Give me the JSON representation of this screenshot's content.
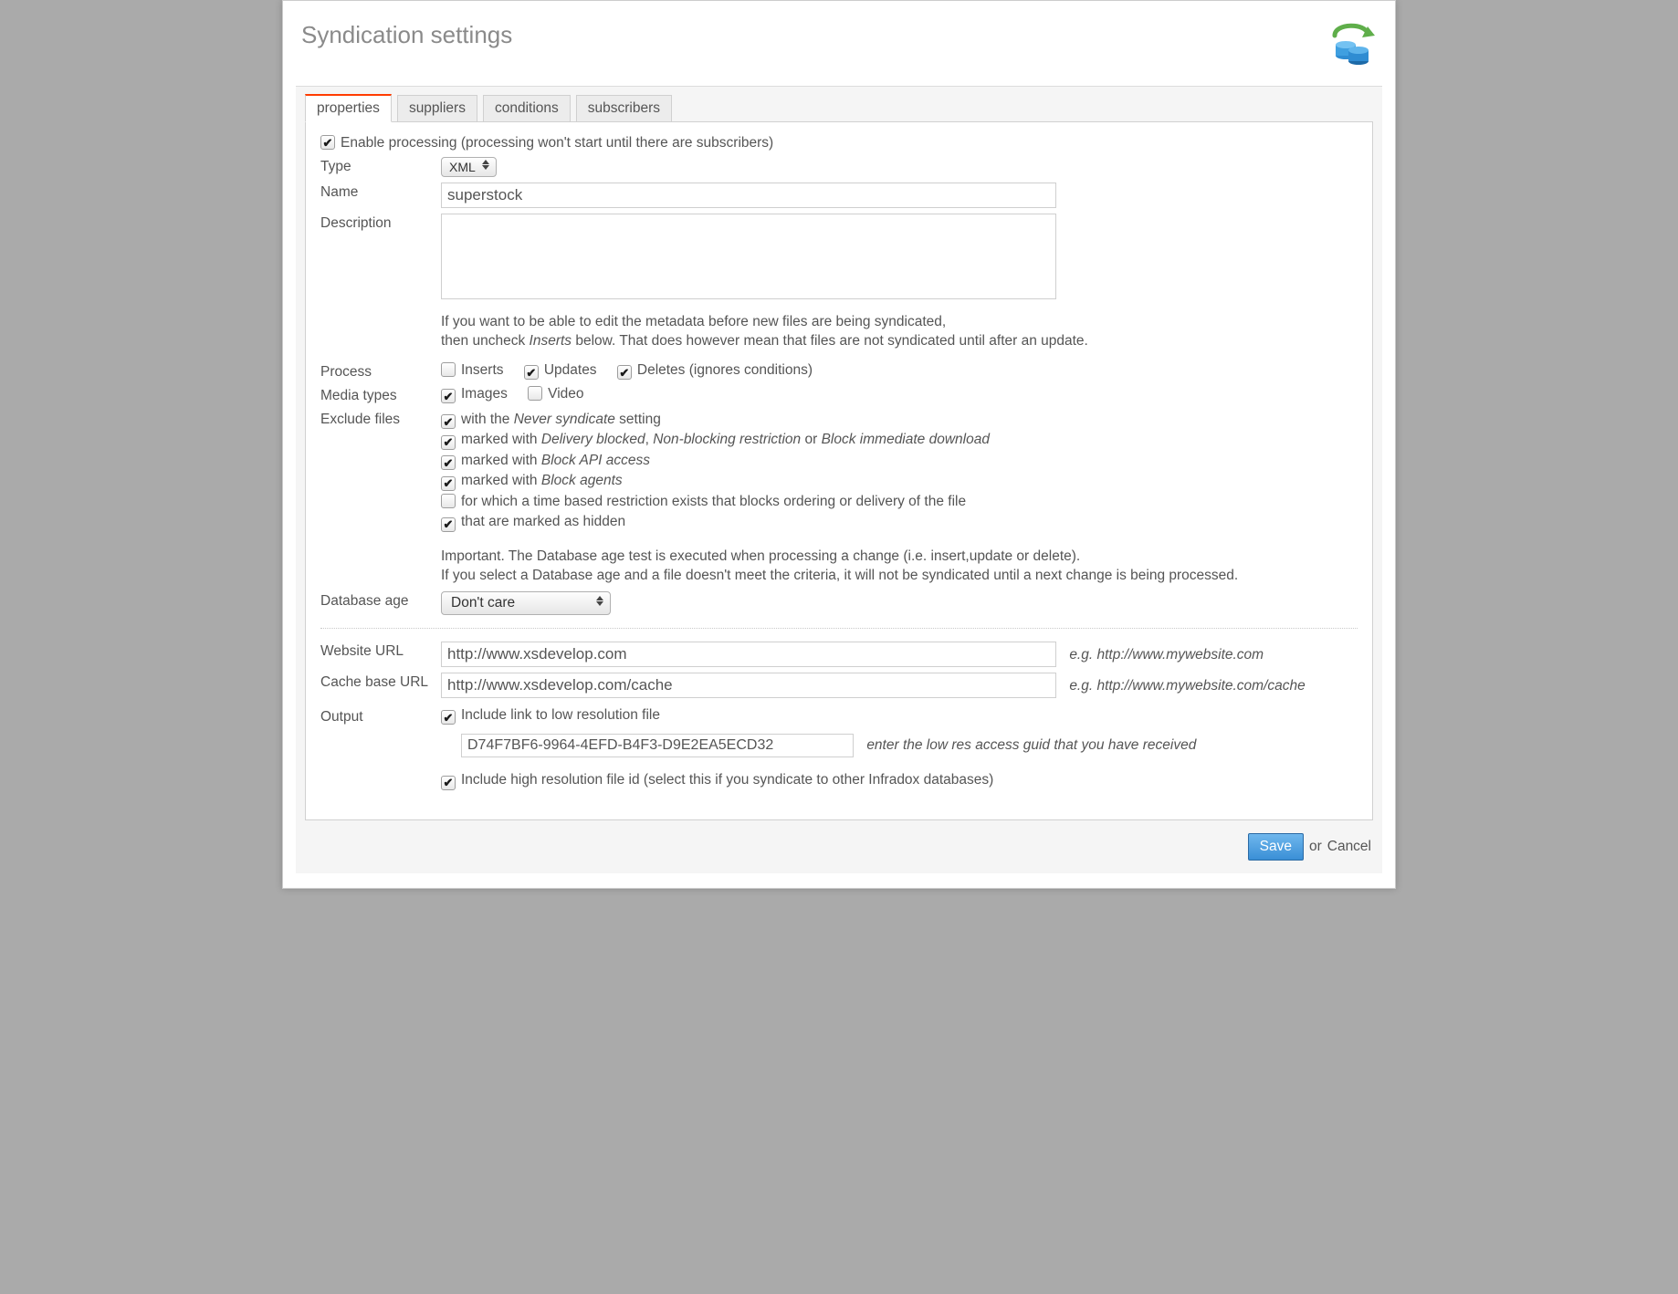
{
  "dialog": {
    "title": "Syndication settings"
  },
  "tabs": {
    "properties": "properties",
    "suppliers": "suppliers",
    "conditions": "conditions",
    "subscribers": "subscribers"
  },
  "enable": {
    "checked": true,
    "label": "Enable processing (processing won't start until there are subscribers)"
  },
  "type": {
    "label": "Type",
    "value": "XML"
  },
  "name": {
    "label": "Name",
    "value": "superstock"
  },
  "description": {
    "label": "Description",
    "value": "",
    "hint1": "If you want to be able to edit the metadata before new files are being syndicated,",
    "hint2_a": "then uncheck ",
    "hint2_em": "Inserts",
    "hint2_b": " below. That does however mean that files are not syndicated until after an update."
  },
  "process": {
    "label": "Process",
    "inserts": {
      "checked": false,
      "label": "Inserts"
    },
    "updates": {
      "checked": true,
      "label": "Updates"
    },
    "deletes": {
      "checked": true,
      "label": "Deletes (ignores conditions)"
    }
  },
  "media": {
    "label": "Media types",
    "images": {
      "checked": true,
      "label": "Images"
    },
    "video": {
      "checked": false,
      "label": "Video"
    }
  },
  "exclude": {
    "label": "Exclude files",
    "e1": {
      "checked": true,
      "pre": "with the ",
      "em": "Never syndicate",
      "post": " setting"
    },
    "e2": {
      "checked": true,
      "pre": "marked with ",
      "em1": "Delivery blocked",
      "mid1": ", ",
      "em2": "Non-blocking restriction",
      "mid2": " or ",
      "em3": "Block immediate download"
    },
    "e3": {
      "checked": true,
      "pre": "marked with ",
      "em": "Block API access"
    },
    "e4": {
      "checked": true,
      "pre": "marked with ",
      "em": "Block agents"
    },
    "e5": {
      "checked": false,
      "text": "for which a time based restriction exists that blocks ordering or delivery of the file"
    },
    "e6": {
      "checked": true,
      "text": "that are marked as hidden"
    },
    "note1": "Important. The Database age test is executed when processing a change (i.e. insert,update or delete).",
    "note2": "If you select a Database age and a file doesn't meet the criteria, it will not be syndicated until a next change is being processed."
  },
  "dbage": {
    "label": "Database age",
    "value": "Don't care"
  },
  "website": {
    "label": "Website URL",
    "value": "http://www.xsdevelop.com",
    "hint": "e.g. http://www.mywebsite.com"
  },
  "cache": {
    "label": "Cache base URL",
    "value": "http://www.xsdevelop.com/cache",
    "hint": "e.g. http://www.mywebsite.com/cache"
  },
  "output": {
    "label": "Output",
    "lowres": {
      "checked": true,
      "label": "Include link to low resolution file"
    },
    "guid": {
      "value": "D74F7BF6-9964-4EFD-B4F3-D9E2EA5ECD32",
      "hint": "enter the low res access guid that you have received"
    },
    "hires": {
      "checked": true,
      "label": "Include high resolution file id (select this if you syndicate to other Infradox databases)"
    }
  },
  "footer": {
    "save": "Save",
    "or": "or",
    "cancel": "Cancel"
  }
}
